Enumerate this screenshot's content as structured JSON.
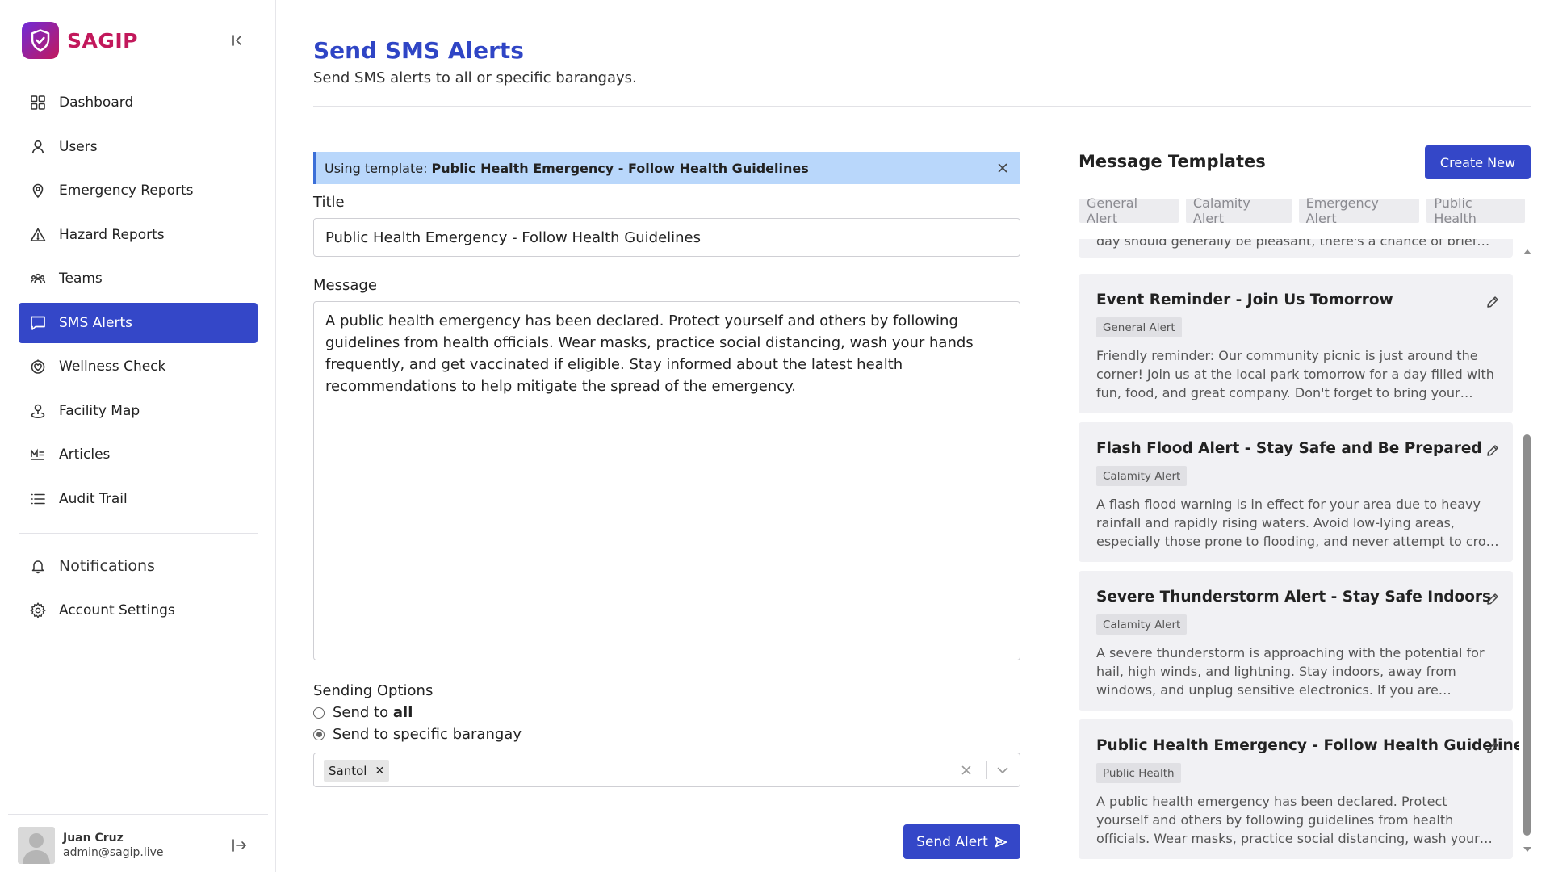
{
  "brand": {
    "name": "SAGIP"
  },
  "sidebar": {
    "items": [
      {
        "label": "Dashboard",
        "icon": "dashboard-icon"
      },
      {
        "label": "Users",
        "icon": "user-icon"
      },
      {
        "label": "Emergency Reports",
        "icon": "location-pin-icon"
      },
      {
        "label": "Hazard Reports",
        "icon": "warning-icon"
      },
      {
        "label": "Teams",
        "icon": "teams-icon"
      },
      {
        "label": "SMS Alerts",
        "icon": "message-icon",
        "active": true
      },
      {
        "label": "Wellness Check",
        "icon": "heart-pulse-icon"
      },
      {
        "label": "Facility Map",
        "icon": "map-pin-icon"
      },
      {
        "label": "Articles",
        "icon": "articles-icon"
      },
      {
        "label": "Audit Trail",
        "icon": "list-icon"
      }
    ],
    "secondary": [
      {
        "label": "Notifications",
        "icon": "bell-icon"
      },
      {
        "label": "Account Settings",
        "icon": "gear-icon"
      }
    ],
    "user": {
      "name": "Juan Cruz",
      "email": "admin@sagip.live"
    }
  },
  "page": {
    "title": "Send SMS Alerts",
    "subtitle": "Send SMS alerts to all or specific barangays."
  },
  "form": {
    "banner_prefix": "Using template:",
    "banner_template": "Public Health Emergency - Follow Health Guidelines",
    "title_label": "Title",
    "title_value": "Public Health Emergency - Follow Health Guidelines",
    "message_label": "Message",
    "message_value": "A public health emergency has been declared. Protect yourself and others by following guidelines from health officials. Wear masks, practice social distancing, wash your hands frequently, and get vaccinated if eligible. Stay informed about the latest health recommendations to help mitigate the spread of the emergency.",
    "sending_options_label": "Sending Options",
    "option_all_prefix": "Send to",
    "option_all_bold": "all",
    "option_specific": "Send to specific barangay",
    "selected_option": "specific",
    "barangays": [
      "Santol"
    ],
    "send_label": "Send Alert"
  },
  "templates": {
    "title": "Message Templates",
    "create_label": "Create New",
    "filters": [
      "General Alert",
      "Calamity Alert",
      "Emergency Alert",
      "Public Health"
    ],
    "partial_body": "day should generally be pleasant, there's a chance of brief showers in the afternoon.",
    "cards": [
      {
        "title": "Event Reminder - Join Us Tomorrow",
        "tag": "General Alert",
        "body": "Friendly reminder: Our community picnic is just around the corner! Join us at the local park tomorrow for a day filled with fun, food, and great company. Don't forget to bring your picnic blankets and favorite dishes to share."
      },
      {
        "title": "Flash Flood Alert - Stay Safe and Be Prepared",
        "tag": "Calamity Alert",
        "body": "A flash flood warning is in effect for your area due to heavy rainfall and rapidly rising waters. Avoid low-lying areas, especially those prone to flooding, and never attempt to cross flooded roads."
      },
      {
        "title": "Severe Thunderstorm Alert - Stay Safe Indoors",
        "tag": "Calamity Alert",
        "body": "A severe thunderstorm is approaching with the potential for hail, high winds, and lightning. Stay indoors, away from windows, and unplug sensitive electronics. If you are outdoors, seek shelter immediately."
      },
      {
        "title": "Public Health Emergency - Follow Health Guidelines",
        "tag": "Public Health",
        "body": "A public health emergency has been declared. Protect yourself and others by following guidelines from health officials. Wear masks, practice social distancing, wash your hands frequently."
      }
    ]
  },
  "colors": {
    "primary": "#3447c8",
    "title": "#2f45c5",
    "brand": "#c2185b",
    "banner": "#b9d7fb"
  }
}
